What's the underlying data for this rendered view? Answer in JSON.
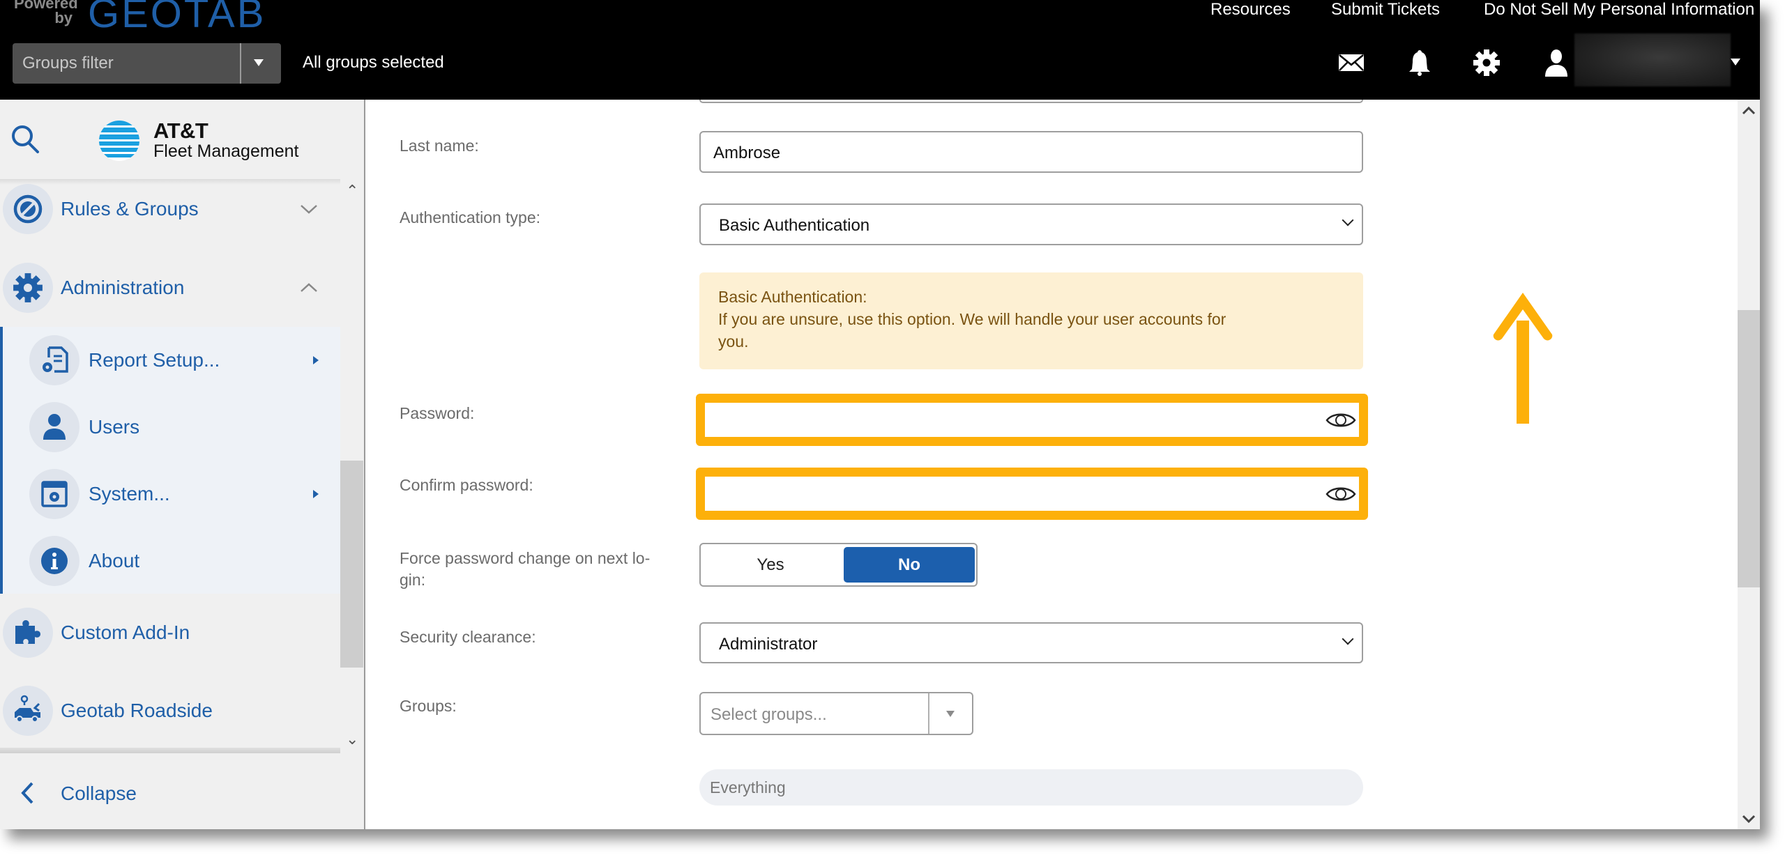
{
  "header": {
    "powered_by": "Powered by",
    "brand": "GEOTAB",
    "groups_filter_placeholder": "Groups filter",
    "groups_status": "All groups selected",
    "links": [
      "Resources",
      "Submit Tickets",
      "Do Not Sell My Personal Information"
    ],
    "icons": [
      "mail-icon",
      "bell-icon",
      "gear-icon",
      "user-icon"
    ]
  },
  "sidebar": {
    "logo_title": "AT&T",
    "logo_subtitle": "Fleet Management",
    "items": [
      {
        "label": "Rules & Groups",
        "icon": "rules-icon",
        "state": "collapsed"
      },
      {
        "label": "Administration",
        "icon": "gear-icon",
        "state": "expanded"
      },
      {
        "label": "Report Setup...",
        "icon": "report-setup-icon",
        "submenu": true
      },
      {
        "label": "Users",
        "icon": "user-icon"
      },
      {
        "label": "System...",
        "icon": "system-icon",
        "submenu": true
      },
      {
        "label": "About",
        "icon": "info-icon"
      },
      {
        "label": "Custom Add-In",
        "icon": "puzzle-icon"
      },
      {
        "label": "Geotab Roadside",
        "icon": "tow-truck-icon"
      }
    ],
    "collapse_label": "Collapse"
  },
  "form": {
    "last_name_label": "Last name:",
    "last_name_value": "Ambrose",
    "auth_type_label": "Authentication type:",
    "auth_type_value": "Basic Authentication",
    "info_title": "Basic Authentication:",
    "info_line1": "If you are unsure, use this option. We will handle your user accounts for",
    "info_line2": "you.",
    "password_label": "Password:",
    "password_value": "",
    "confirm_password_label": "Confirm password:",
    "confirm_password_value": "",
    "force_change_label_line1": "Force password change on next lo-",
    "force_change_label_line2": "gin:",
    "force_change_options": [
      "Yes",
      "No"
    ],
    "force_change_selected": "No",
    "security_label": "Security clearance:",
    "security_value": "Administrator",
    "groups_label": "Groups:",
    "groups_placeholder": "Select groups...",
    "groups_chip": "Everything"
  },
  "annotation": {
    "highlight_color": "#fdb00a",
    "arrow_direction": "up"
  },
  "colors": {
    "brand_blue": "#1f5fa8",
    "toggle_active": "#1c5fad",
    "info_bg": "#fdf0d3",
    "info_text": "#7a5312"
  }
}
